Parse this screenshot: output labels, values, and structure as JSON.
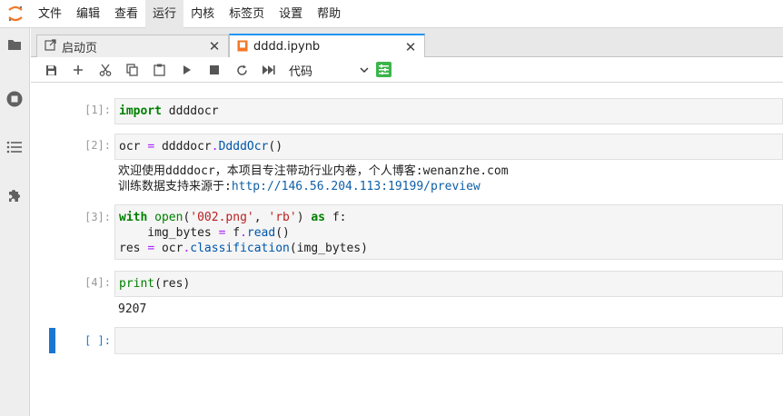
{
  "menu": {
    "items": [
      "文件",
      "编辑",
      "查看",
      "运行",
      "内核",
      "标签页",
      "设置",
      "帮助"
    ],
    "active_index": 3
  },
  "sidebar": {
    "icons": [
      "folder-icon",
      "running-icon",
      "toc-icon",
      "extension-icon"
    ]
  },
  "tabs": [
    {
      "label": "启动页",
      "icon": "launcher-icon"
    },
    {
      "label": "dddd.ipynb",
      "icon": "notebook-icon"
    }
  ],
  "toolbar": {
    "buttons": [
      "save-icon",
      "add-icon",
      "cut-icon",
      "copy-icon",
      "paste-icon",
      "run-icon",
      "stop-icon",
      "restart-icon",
      "fast-forward-icon"
    ],
    "cell_type": "代码"
  },
  "cells": [
    {
      "prompt": "[1]:"
    },
    {
      "prompt": "[2]:",
      "output_line1": "欢迎使用ddddocr，本项目专注带动行业内卷，个人博客:wenanzhe.com",
      "output_line2_label": "训练数据支持来源于:",
      "output_line2_link": "http://146.56.204.113:19199/preview"
    },
    {
      "prompt": "[3]:"
    },
    {
      "prompt": "[4]:",
      "output": "9207"
    },
    {
      "prompt": "[ ]:"
    }
  ],
  "colors": {
    "accent": "#2196f3",
    "active_cell_bar": "#1976d2",
    "keyword": "#008000",
    "string": "#ba2121"
  }
}
